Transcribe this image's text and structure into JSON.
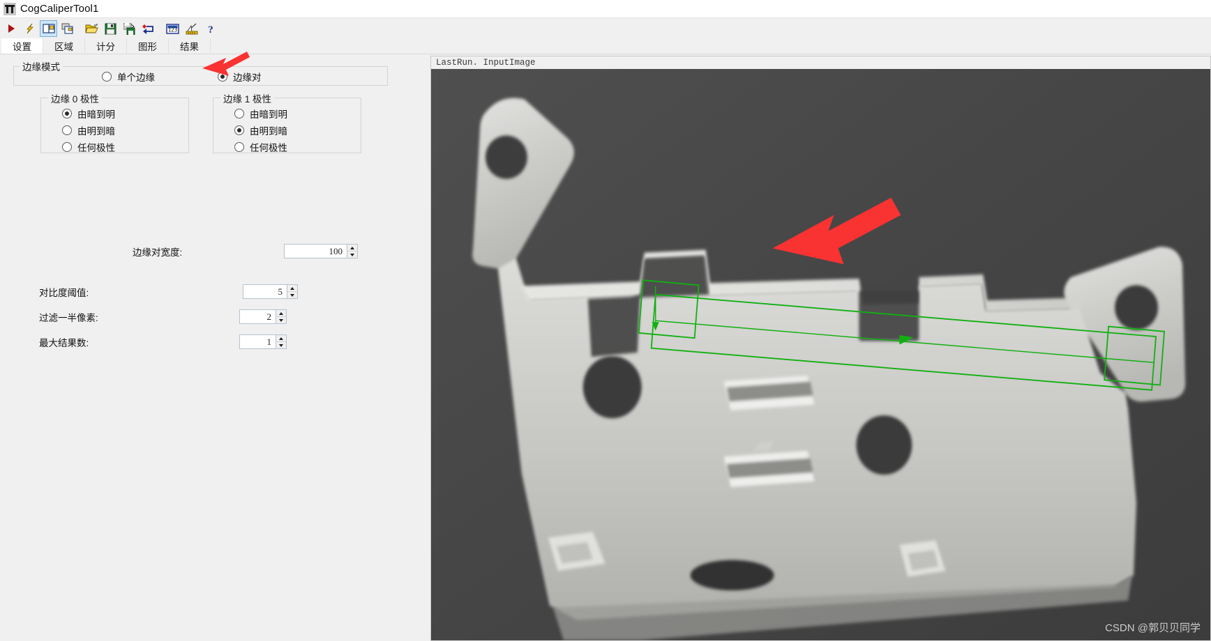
{
  "window": {
    "title": "CogCaliperTool1",
    "icon": "caliper-tool-icon"
  },
  "toolbar": {
    "buttons": [
      {
        "name": "run-button",
        "label": "Run",
        "icon": "red-play-triangle-icon"
      },
      {
        "name": "train-button",
        "label": "Train",
        "icon": "yellow-lightning-icon"
      },
      {
        "name": "show-display-button",
        "label": "Show Display",
        "icon": "dual-pane-window-icon",
        "pressed": true
      },
      {
        "name": "add-display-button",
        "label": "Add Display",
        "icon": "stacked-window-icon"
      },
      {
        "name": "open-button",
        "label": "Open",
        "icon": "open-folder-icon"
      },
      {
        "name": "save-button",
        "label": "Save",
        "icon": "floppy-disk-icon"
      },
      {
        "name": "save-as-button",
        "label": "Save As",
        "icon": "floppy-disk-pencil-icon"
      },
      {
        "name": "restore-defaults-button",
        "label": "Restore",
        "icon": "red-diamond-arrow-icon"
      },
      {
        "name": "numeric-results-button",
        "label": "Numeric Results",
        "icon": "numeric-123-icon"
      },
      {
        "name": "measure-button",
        "label": "Measure",
        "icon": "ruler-caliper-icon"
      },
      {
        "name": "help-button",
        "label": "Help",
        "icon": "question-mark-icon"
      }
    ]
  },
  "tabs": [
    {
      "label": "设置",
      "name": "tab-settings",
      "active": true
    },
    {
      "label": "区域",
      "name": "tab-region",
      "active": false
    },
    {
      "label": "计分",
      "name": "tab-scoring",
      "active": false
    },
    {
      "label": "图形",
      "name": "tab-graphics",
      "active": false
    },
    {
      "label": "结果",
      "name": "tab-results",
      "active": false
    }
  ],
  "settings": {
    "edge_mode": {
      "legend": "边缘模式",
      "options": [
        {
          "label": "单个边缘",
          "checked": false
        },
        {
          "label": "边缘对",
          "checked": true
        }
      ]
    },
    "polarity_0": {
      "legend": "边缘 0 极性",
      "options": [
        {
          "label": "由暗到明",
          "checked": true
        },
        {
          "label": "由明到暗",
          "checked": false
        },
        {
          "label": "任何极性",
          "checked": false
        }
      ]
    },
    "polarity_1": {
      "legend": "边缘 1 极性",
      "options": [
        {
          "label": "由暗到明",
          "checked": false
        },
        {
          "label": "由明到暗",
          "checked": true
        },
        {
          "label": "任何极性",
          "checked": false
        }
      ]
    },
    "pair_width": {
      "label": "边缘对宽度:",
      "value": "100"
    },
    "contrast_threshold": {
      "label": "对比度阈值:",
      "value": "5"
    },
    "filter_half_pixels": {
      "label": "过滤一半像素:",
      "value": "2"
    },
    "max_results": {
      "label": "最大结果数:",
      "value": "1"
    }
  },
  "viewer": {
    "header": "LastRun. InputImage",
    "watermark": "CSDN @郭贝贝同学",
    "overlay_color": "#11b011",
    "annotation_arrow_color": "#f93232",
    "background": "#4a4a4a"
  }
}
